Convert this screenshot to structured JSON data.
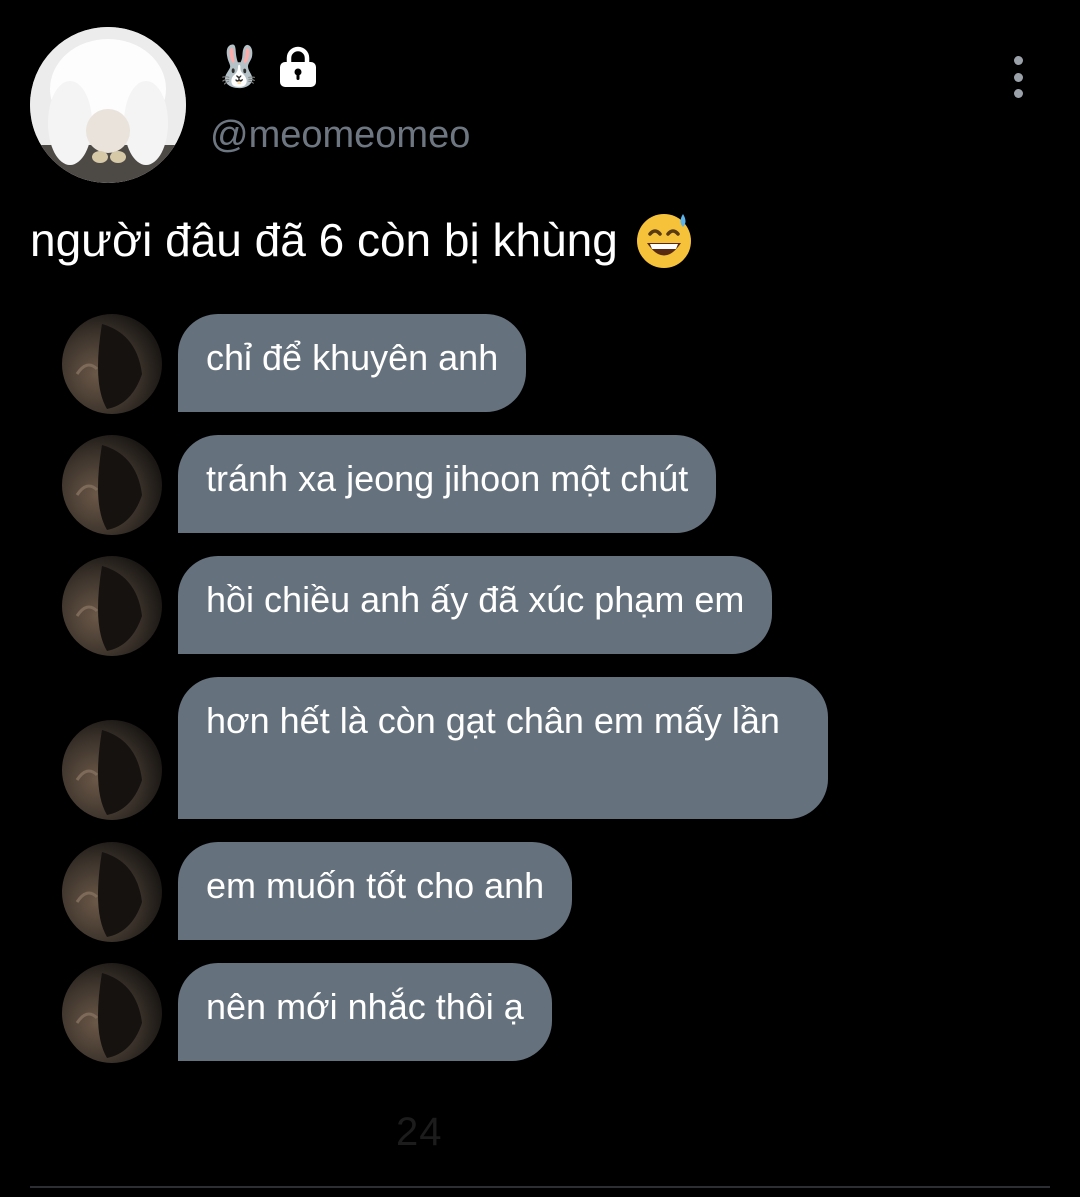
{
  "author": {
    "name_emoji": "🐰",
    "handle": "@meomeomeo",
    "protected_icon": "lock-icon",
    "avatar_icon": "white-rabbit-photo"
  },
  "tweet": {
    "text": "người đâu đã 6 còn bị khùng",
    "emoji_icon": "grinning-face-with-sweat-emoji"
  },
  "menu": {
    "icon": "vertical-ellipsis-icon"
  },
  "chat_messages": [
    {
      "text": "chỉ để khuyên anh"
    },
    {
      "text": "tránh xa jeong jihoon một chút"
    },
    {
      "text": "hồi chiều anh ấy đã xúc phạm em"
    },
    {
      "text": "hơn hết là còn gạt chân em mấy lần"
    },
    {
      "text": "em muốn tốt cho anh"
    },
    {
      "text": "nên mới nhắc thôi ạ"
    }
  ],
  "footer": {
    "faded_text": "24"
  },
  "colors": {
    "background": "#000000",
    "bubble": "#65717d",
    "handle": "#6e7781",
    "text": "#ffffff"
  }
}
